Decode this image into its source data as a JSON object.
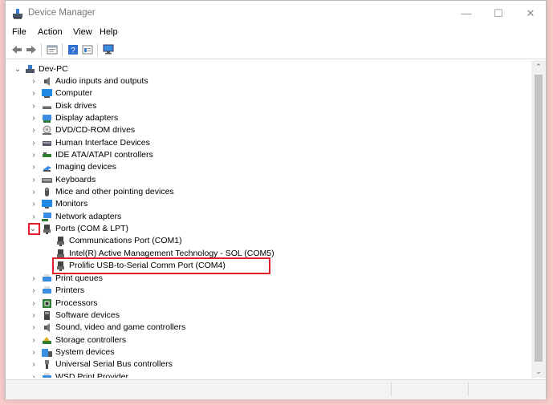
{
  "window": {
    "title": "Device Manager",
    "controls": {
      "minimize": "—",
      "maximize": "☐",
      "close": "✕"
    }
  },
  "menu": [
    "File",
    "Action",
    "View",
    "Help"
  ],
  "toolbar": [
    "back-icon",
    "forward-icon",
    "properties-icon",
    "help-icon",
    "details-icon",
    "scan-hardware-icon"
  ],
  "tree": {
    "root": {
      "label": "Dev-PC",
      "expanded": true
    },
    "categories": [
      {
        "label": "Audio inputs and outputs",
        "icon": "speaker-icon"
      },
      {
        "label": "Computer",
        "icon": "computer-icon"
      },
      {
        "label": "Disk drives",
        "icon": "disk-drive-icon"
      },
      {
        "label": "Display adapters",
        "icon": "display-adapter-icon"
      },
      {
        "label": "DVD/CD-ROM drives",
        "icon": "dvd-drive-icon"
      },
      {
        "label": "Human Interface Devices",
        "icon": "hid-icon"
      },
      {
        "label": "IDE ATA/ATAPI controllers",
        "icon": "ide-controller-icon"
      },
      {
        "label": "Imaging devices",
        "icon": "camera-icon"
      },
      {
        "label": "Keyboards",
        "icon": "keyboard-icon"
      },
      {
        "label": "Mice and other pointing devices",
        "icon": "mouse-icon"
      },
      {
        "label": "Monitors",
        "icon": "monitor-icon"
      },
      {
        "label": "Network adapters",
        "icon": "network-adapter-icon"
      },
      {
        "label": "Ports (COM & LPT)",
        "icon": "port-icon",
        "expanded": true,
        "children": [
          {
            "label": "Communications Port (COM1)",
            "icon": "port-icon"
          },
          {
            "label": "Intel(R) Active Management Technology - SOL (COM5)",
            "icon": "port-icon"
          },
          {
            "label": "Prolific USB-to-Serial Comm Port (COM4)",
            "icon": "port-icon",
            "highlighted": true
          }
        ]
      },
      {
        "label": "Print queues",
        "icon": "print-queue-icon"
      },
      {
        "label": "Printers",
        "icon": "printer-icon"
      },
      {
        "label": "Processors",
        "icon": "processor-icon"
      },
      {
        "label": "Software devices",
        "icon": "software-device-icon"
      },
      {
        "label": "Sound, video and game controllers",
        "icon": "sound-icon"
      },
      {
        "label": "Storage controllers",
        "icon": "storage-controller-icon"
      },
      {
        "label": "System devices",
        "icon": "system-device-icon"
      },
      {
        "label": "Universal Serial Bus controllers",
        "icon": "usb-icon"
      },
      {
        "label": "WSD Print Provider",
        "icon": "wsd-printer-icon"
      }
    ]
  },
  "colors": {
    "highlight_box": "#e0212b",
    "background": "#f7c9c9"
  }
}
